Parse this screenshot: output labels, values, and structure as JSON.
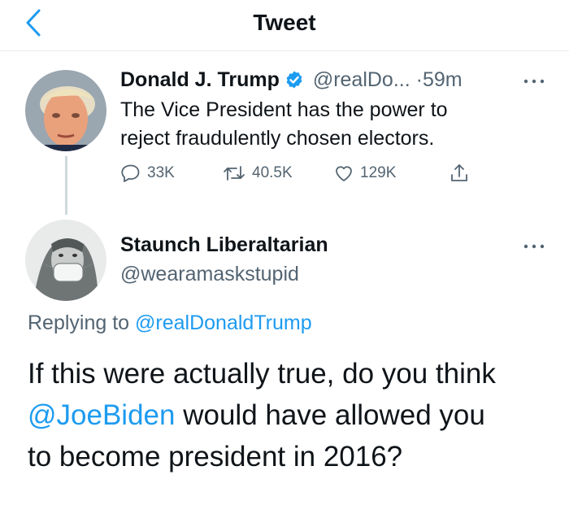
{
  "header": {
    "title": "Tweet",
    "back_icon": "chevron-left-icon"
  },
  "colors": {
    "accent": "#1d9bf0",
    "secondary_text": "#536471",
    "text": "#0f1419"
  },
  "tweet": {
    "author_name": "Donald J. Trump",
    "handle": "@realDo...",
    "separator": "·",
    "time": "59m",
    "text_line1": "The Vice President has the power to",
    "text_line2": "reject fraudulently chosen electors.",
    "replies": "33K",
    "retweets": "40.5K",
    "likes": "129K"
  },
  "reply": {
    "author_name": "Staunch Liberaltarian",
    "handle": "@wearamaskstupid",
    "replying_prefix": "Replying to",
    "replying_to": "@realDonaldTrump",
    "text_part1": "If this were actually true, do you think",
    "mention": "@JoeBiden",
    "text_part2": " would have allowed you",
    "text_part3": "to become president in 2016?"
  }
}
